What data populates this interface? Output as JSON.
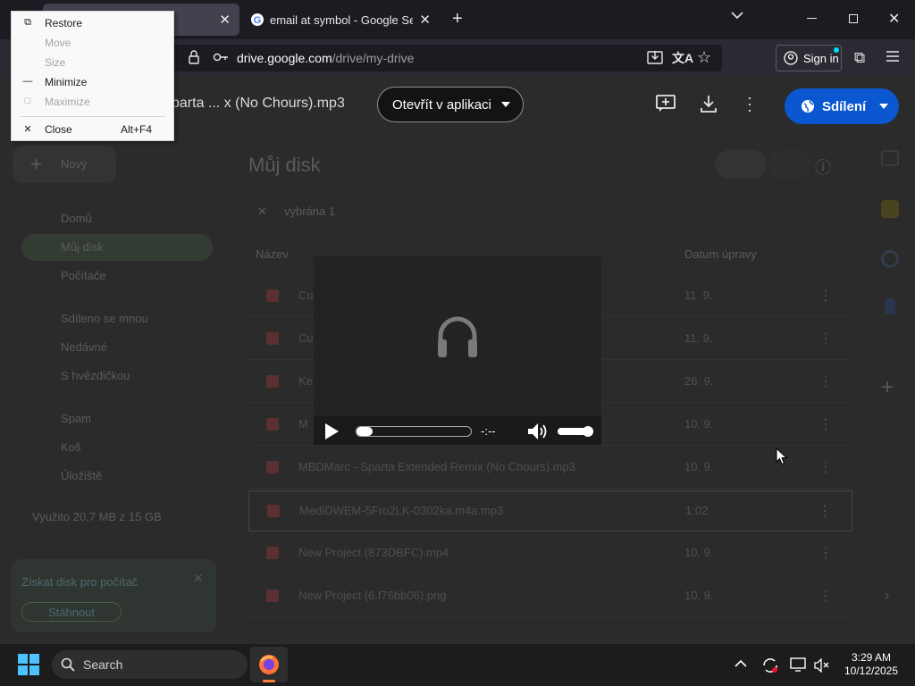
{
  "browser": {
    "tab1_title": "e",
    "tab2_title": "email at symbol - Google Search",
    "new_tab_icon": "plus-icon",
    "url_domain": "drive.google.com",
    "url_path": "/drive/my-drive",
    "signin_label": "Sign in"
  },
  "context_menu": {
    "items": [
      {
        "label": "Restore",
        "shortcut": "",
        "enabled": true
      },
      {
        "label": "Move",
        "shortcut": "",
        "enabled": false
      },
      {
        "label": "Size",
        "shortcut": "",
        "enabled": false
      },
      {
        "label": "Minimize",
        "shortcut": "",
        "enabled": true
      },
      {
        "label": "Maximize",
        "shortcut": "",
        "enabled": false
      },
      {
        "label": "Close",
        "shortcut": "Alt+F4",
        "enabled": true
      }
    ]
  },
  "drive": {
    "file_title": "parta ... x (No Chours).mp3",
    "open_in_app": "Otevřít v aplikaci",
    "share": "Sdílení",
    "new_button": "Nový",
    "heading": "Můj disk",
    "selected": "vybrána 1",
    "col_name": "Název",
    "col_date": "Datum úpravy",
    "nav": [
      "Domů",
      "Můj disk",
      "Počítače",
      "Sdíleno se mnou",
      "Nedávné",
      "S hvězdičkou",
      "Spam",
      "Koš",
      "Úložiště"
    ],
    "storage_used": "Využito 20,7 MB z 15 GB",
    "promo_text": "Získat disk pro počítač",
    "promo_button": "Stáhnout",
    "rows": [
      {
        "name": "Cu",
        "date": "11. 9."
      },
      {
        "name": "Cu",
        "date": "11. 9."
      },
      {
        "name": "Ke",
        "date": "26. 9."
      },
      {
        "name": "M",
        "date": "10. 9."
      },
      {
        "name": "MBDMarc - Sparta Extended Remix (No Chours).mp3",
        "date": "10. 9."
      },
      {
        "name": "MediDWEM-5Fro2LK-0302ka.m4a.mp3",
        "date": "1:02"
      },
      {
        "name": "New Project (873DBFC).mp4",
        "date": "10. 9."
      },
      {
        "name": "New Project (6.f76bb06).png",
        "date": "10. 9."
      }
    ]
  },
  "player": {
    "time": "-:--",
    "volume_fraction": 0.85,
    "progress_fraction": 0.0
  },
  "taskbar": {
    "search_label": "Search",
    "time": "3:29 AM",
    "date": "10/12/2025"
  }
}
